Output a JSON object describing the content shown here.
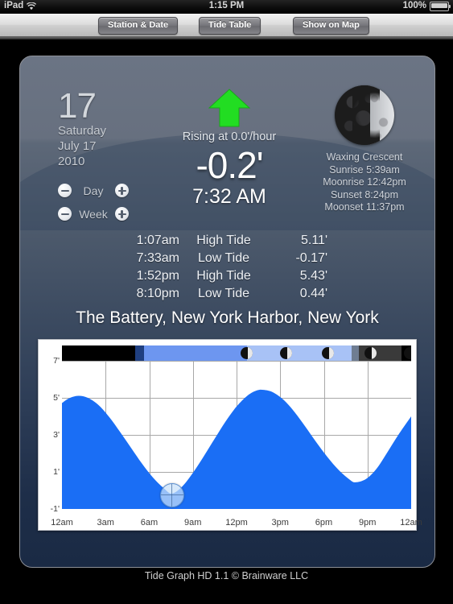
{
  "statusbar": {
    "device": "iPad",
    "wifi_icon": "wifi-icon",
    "time": "1:15 PM",
    "battery_percent": "100%",
    "battery_icon": "battery-full-icon"
  },
  "toolbar": {
    "station_date": "Station & Date",
    "tide_table": "Tide Table",
    "show_on_map": "Show on Map"
  },
  "date": {
    "day_number": "17",
    "weekday": "Saturday",
    "month_day": "July 17",
    "year": "2010"
  },
  "steppers": [
    {
      "label": "Day",
      "minus": "minus-icon",
      "plus": "plus-icon"
    },
    {
      "label": "Week",
      "minus": "minus-icon",
      "plus": "plus-icon"
    }
  ],
  "current": {
    "arrow_icon": "arrow-up-green-icon",
    "arrow_color": "#22dd22",
    "trend": "Rising at 0.0'/hour",
    "height": "-0.2'",
    "time": "7:32 AM"
  },
  "moon": {
    "phase": "Waxing Crescent",
    "sunrise": "Sunrise 5:39am",
    "moonrise": "Moonrise 12:42pm",
    "sunset": "Sunset 8:24pm",
    "moonset": "Moonset 11:37pm"
  },
  "tides": [
    {
      "time": "1:07am",
      "kind": "High Tide",
      "value": "5.11'"
    },
    {
      "time": "7:33am",
      "kind": "Low Tide",
      "value": "-0.17'"
    },
    {
      "time": "1:52pm",
      "kind": "High Tide",
      "value": "5.43'"
    },
    {
      "time": "8:10pm",
      "kind": "Low Tide",
      "value": "0.44'"
    }
  ],
  "station": "The Battery, New York Harbor, New York",
  "footer": "Tide Graph HD 1.1 © Brainware LLC",
  "chart_data": {
    "type": "line",
    "title": "The Battery, New York Harbor, New York",
    "xlabel": "",
    "ylabel": "",
    "xlim": [
      0,
      24
    ],
    "ylim": [
      -1,
      7
    ],
    "grid": true,
    "legend": "none",
    "fill_color": "#1a6ef5",
    "xticks": [
      "12am",
      "3am",
      "6am",
      "9am",
      "12pm",
      "3pm",
      "6pm",
      "9pm",
      "12am"
    ],
    "xtick_hours": [
      0,
      3,
      6,
      9,
      12,
      15,
      18,
      21,
      24
    ],
    "yticks": [
      "7'",
      "5'",
      "3'",
      "1'",
      "-1'"
    ],
    "ytick_values": [
      7,
      5,
      3,
      1,
      -1
    ],
    "extrema": [
      {
        "hour": 1.117,
        "value": 5.11,
        "kind": "High Tide"
      },
      {
        "hour": 7.55,
        "value": -0.17,
        "kind": "Low Tide"
      },
      {
        "hour": 13.867,
        "value": 5.43,
        "kind": "High Tide"
      },
      {
        "hour": 20.167,
        "value": 0.44,
        "kind": "Low Tide"
      }
    ],
    "series": [
      {
        "name": "Tide height",
        "x": [
          0,
          0.5,
          1.117,
          1.75,
          2.5,
          3.25,
          4,
          4.75,
          5.5,
          6.25,
          7,
          7.55,
          8.25,
          9,
          9.75,
          10.5,
          11.25,
          12,
          12.75,
          13.4,
          13.867,
          14.5,
          15.25,
          16,
          16.75,
          17.5,
          18.25,
          19,
          19.75,
          20.167,
          20.9,
          21.6,
          22.3,
          23.1,
          24
        ],
        "values": [
          4.72,
          4.98,
          5.11,
          5.01,
          4.62,
          3.96,
          3.15,
          2.3,
          1.45,
          0.7,
          0.12,
          -0.17,
          0.2,
          0.95,
          1.85,
          2.8,
          3.73,
          4.53,
          5.12,
          5.4,
          5.43,
          5.3,
          4.88,
          4.22,
          3.42,
          2.58,
          1.8,
          1.12,
          0.6,
          0.44,
          0.62,
          1.15,
          1.98,
          2.98,
          4.0
        ]
      }
    ],
    "now_marker": {
      "hour": 7.533,
      "value": -0.2,
      "label": "7:32 AM"
    },
    "daynight_bar": {
      "segments": [
        {
          "start_hour": 0,
          "end_hour": 5.05,
          "type": "night",
          "color": "#000000"
        },
        {
          "start_hour": 5.05,
          "end_hour": 5.65,
          "type": "dawn",
          "color": "#1f3f80"
        },
        {
          "start_hour": 5.65,
          "end_hour": 12.7,
          "type": "day",
          "color": "#6d96f0"
        },
        {
          "start_hour": 12.7,
          "end_hour": 19.9,
          "type": "day-late",
          "color": "#a8c2f6"
        },
        {
          "start_hour": 19.9,
          "end_hour": 20.4,
          "type": "dusk",
          "color": "#6f7d92"
        },
        {
          "start_hour": 20.4,
          "end_hour": 23.35,
          "type": "evening",
          "color": "#3a3a3a"
        },
        {
          "start_hour": 23.35,
          "end_hour": 24,
          "type": "night",
          "color": "#000000"
        }
      ],
      "moon_markers_hours": [
        12.7,
        15.4,
        18.3,
        21.2,
        23.9
      ]
    }
  }
}
